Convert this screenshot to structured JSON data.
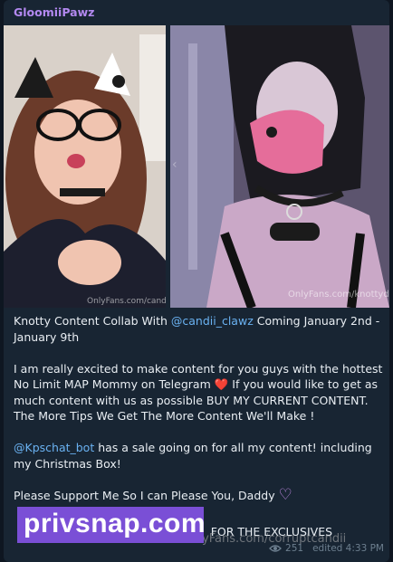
{
  "post": {
    "sender": "GloomiiPawz",
    "photos": [
      {
        "watermark": "OnlyFans.com/candiipop"
      },
      {
        "watermark": "OnlyFans.com/knottydawz"
      }
    ],
    "nav_left": "‹",
    "text": {
      "p1_pre": "Knotty Content Collab With ",
      "p1_mention": "@candii_clawz",
      "p1_post": " Coming January 2nd - January 9th",
      "p2_pre": "I am really excited to make content for you guys with the hottest No Limit MAP Mommy on Telegram ",
      "p2_heart": "❤️",
      "p2_post": " If you would like to get as much content with us as possible BUY MY CURRENT CONTENT. The More Tips We Get The More Content We'll Make !",
      "p3_mention": "@Kpschat_bot",
      "p3_post": " has a sale going on for all my content! including my Christmas Box!",
      "p4_pre": "Please Support Me So I can Please You, Daddy ",
      "p4_heart": "♡",
      "p5_visible": "FOR THE EXCLUSIVES"
    },
    "overlay_brand": "privsnap.com",
    "bottom_watermark": "OnlyFans.com/corruptcandii",
    "views": "251",
    "edited": "edited 4:33 PM"
  },
  "colors": {
    "sender": "#b389f0",
    "mention": "#6ab2f2",
    "bubble": "#182533",
    "brand_banner": "#7a4fd6"
  },
  "icons": [
    "eye-icon"
  ]
}
